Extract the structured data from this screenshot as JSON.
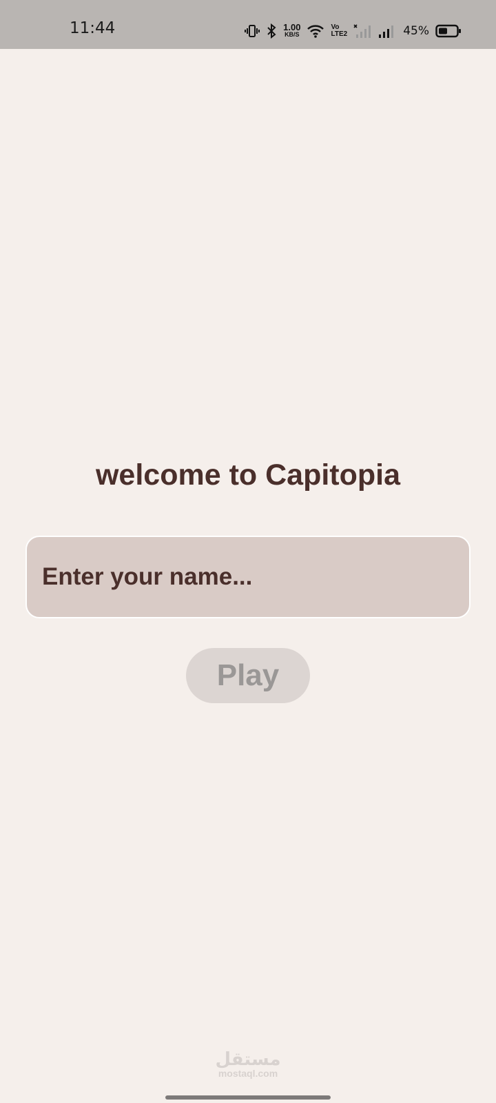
{
  "status_bar": {
    "time": "11:44",
    "net_speed_value": "1.00",
    "net_speed_unit": "KB/S",
    "volte_top": "Vo",
    "volte_bottom": "LTE2",
    "battery_percent": "45%",
    "icons": [
      "vibrate-icon",
      "bluetooth-icon",
      "wifi-icon",
      "volte-icon",
      "signal-sim2-icon",
      "signal-sim1-icon",
      "battery-icon"
    ]
  },
  "main": {
    "title": "welcome to Capitopia",
    "name_input": {
      "value": "",
      "placeholder": "Enter your name..."
    },
    "play_label": "Play"
  },
  "watermark": {
    "arabic": "مستقل",
    "latin": "mostaql.com"
  },
  "colors": {
    "background": "#f5efeb",
    "status_bar": "#b9b5b2",
    "title_text": "#4a2f2b",
    "input_fill": "#d9cbc6",
    "button_disabled_fill": "#dcd5d2",
    "button_disabled_text": "#9a9796"
  }
}
